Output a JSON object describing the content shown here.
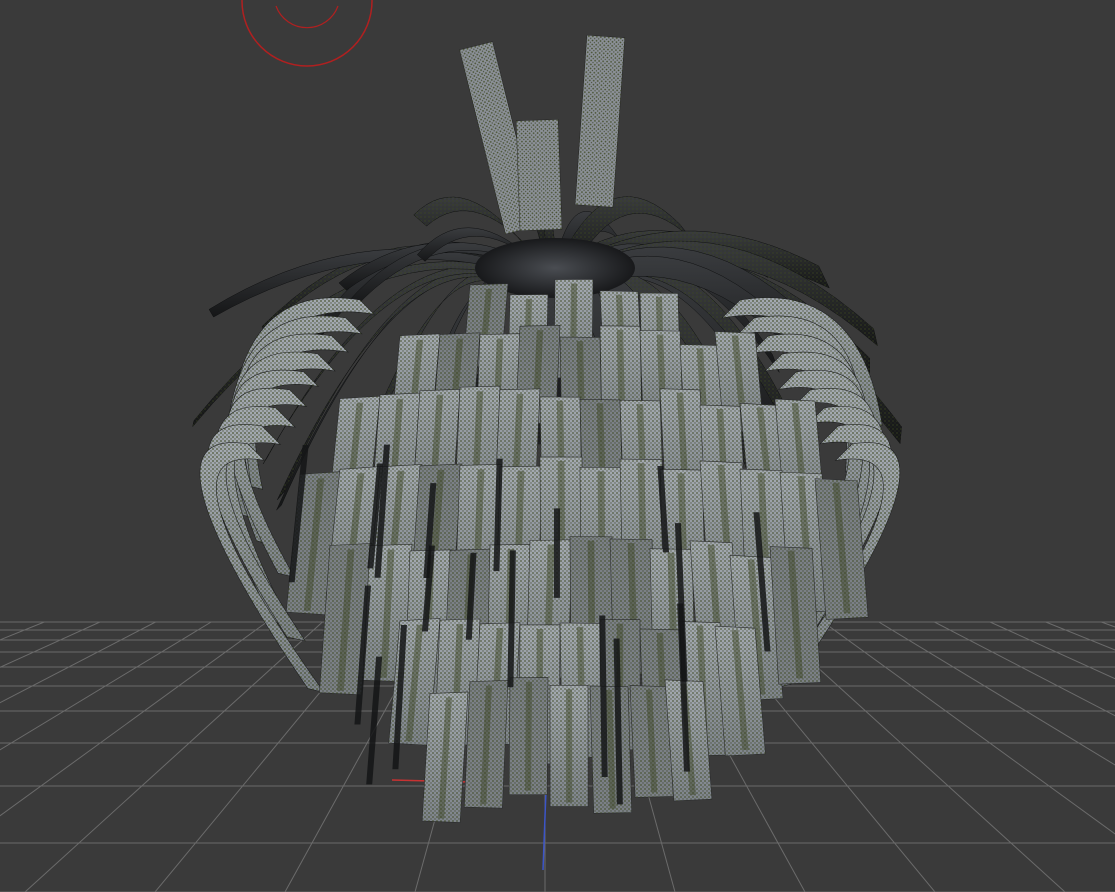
{
  "viewport": {
    "background_color": "#3a3a3a",
    "grid_color": "#6b6b6b",
    "x_axis_color": "#c83232",
    "z_axis_color": "#3c55c8"
  },
  "gizmo": {
    "icon": "rotate-gizmo-icon",
    "color": "#b02020"
  },
  "model": {
    "icon": "plant-mesh-icon",
    "leaf_base_color": "#8e949a",
    "leaf_dark_color": "#1c1d1e",
    "leaf_texture_color": "#3c4620",
    "core_color": "#2a2b2d"
  }
}
